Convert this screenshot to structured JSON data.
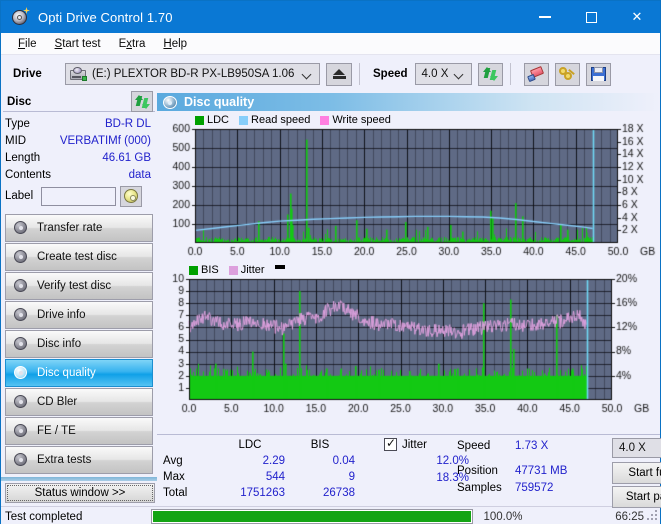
{
  "window": {
    "title": "Opti Drive Control 1.70",
    "app_icon": "disc-icon",
    "minimize": "minimize-icon",
    "maximize": "maximize-icon",
    "close": "close-icon",
    "titlebar_color": "#0a78d4"
  },
  "menu": [
    {
      "label": "File"
    },
    {
      "label": "Start test"
    },
    {
      "label": "Extra"
    },
    {
      "label": "Help"
    }
  ],
  "toolbar": {
    "drive_label": "Drive",
    "drive_value": "(E:)   PLEXTOR BD-R  PX-LB950SA 1.06",
    "eject_title": "eject-icon",
    "speed_label": "Speed",
    "speed_value": "4.0 X",
    "refresh_icon": "refresh-icon",
    "erase_icon": "eraser-icon",
    "keys_icon": "keys-icon",
    "save_icon": "save-icon"
  },
  "disc_panel": {
    "header": "Disc",
    "refresh_icon": "refresh-icon",
    "rows": [
      {
        "key": "Type",
        "value": "BD-R DL"
      },
      {
        "key": "MID",
        "value": "VERBATIMf (000)"
      },
      {
        "key": "Length",
        "value": "46.61 GB"
      },
      {
        "key": "Contents",
        "value": "data"
      }
    ],
    "label_key": "Label",
    "label_value": "",
    "label_placeholder": "",
    "label_button_icon": "cd-icon"
  },
  "nav": {
    "items": [
      {
        "label": "Transfer rate",
        "icon": "disc-transfer-icon",
        "active": false
      },
      {
        "label": "Create test disc",
        "icon": "disc-create-icon",
        "active": false
      },
      {
        "label": "Verify test disc",
        "icon": "disc-verify-icon",
        "active": false
      },
      {
        "label": "Drive info",
        "icon": "disc-drive-icon",
        "active": false
      },
      {
        "label": "Disc info",
        "icon": "disc-info-icon",
        "active": false
      },
      {
        "label": "Disc quality",
        "icon": "disc-quality-icon",
        "active": true
      },
      {
        "label": "CD Bler",
        "icon": "disc-bler-icon",
        "active": false
      },
      {
        "label": "FE / TE",
        "icon": "disc-fete-icon",
        "active": false
      },
      {
        "label": "Extra tests",
        "icon": "disc-extra-icon",
        "active": false
      }
    ],
    "status_window_button": "Status window >>"
  },
  "panel": {
    "title": "Disc quality",
    "title_icon": "disc-quality-icon"
  },
  "stats": {
    "col_headers": [
      "LDC",
      "BIS"
    ],
    "rows": [
      {
        "label": "Avg",
        "ldc": "2.29",
        "bis": "0.04"
      },
      {
        "label": "Max",
        "ldc": "544",
        "bis": "9"
      },
      {
        "label": "Total",
        "ldc": "1751263",
        "bis": "26738"
      }
    ],
    "jitter_label": "Jitter",
    "jitter_checked": true,
    "jitter_avg": "12.0%",
    "jitter_max": "18.3%",
    "speed_key": "Speed",
    "speed_value": "1.73 X",
    "position_key": "Position",
    "position_value": "47731 MB",
    "samples_key": "Samples",
    "samples_value": "759572",
    "speed_select": "4.0 X",
    "start_full": "Start full",
    "start_part": "Start part"
  },
  "statusbar": {
    "status": "Test completed",
    "progress_pct_label": "100.0%",
    "progress_value": 100,
    "elapsed": "66:25",
    "bar_color": "#13a413"
  },
  "chart_data": [
    {
      "type": "line",
      "name": "top-chart-ldc",
      "title": "",
      "xlabel": "GB",
      "ylabel": "",
      "xlim": [
        0,
        50
      ],
      "ylim": [
        0,
        600
      ],
      "y2lim": [
        0,
        18
      ],
      "grid": true,
      "legend": [
        {
          "label": "LDC",
          "color": "#00a000"
        },
        {
          "label": "Read speed",
          "color": "#87cefa"
        },
        {
          "label": "Write speed",
          "color": "#ff7fe0"
        }
      ],
      "xticks": [
        "0.0",
        "5.0",
        "10.0",
        "15.0",
        "20.0",
        "25.0",
        "30.0",
        "35.0",
        "40.0",
        "45.0",
        "50.0"
      ],
      "yticks": [
        "600",
        "500",
        "400",
        "300",
        "200",
        "100"
      ],
      "y2ticks": [
        "18 X",
        "16 X",
        "14 X",
        "12 X",
        "10 X",
        "8 X",
        "6 X",
        "4 X",
        "2 X"
      ],
      "data_end_gb": 47.0,
      "series": [
        {
          "name": "Read speed",
          "color": "#87cefa",
          "axis": "right",
          "x": [
            0,
            2,
            4,
            6,
            8,
            10,
            12,
            14,
            16,
            18,
            20,
            22,
            24,
            26,
            28,
            30,
            32,
            34,
            36,
            38,
            40,
            42,
            44,
            46,
            47
          ],
          "y": [
            2.0,
            2.3,
            2.6,
            2.9,
            3.2,
            3.45,
            3.6,
            3.75,
            3.85,
            3.95,
            4.05,
            4.1,
            4.15,
            4.2,
            4.2,
            4.2,
            4.15,
            4.1,
            3.95,
            3.7,
            3.4,
            3.1,
            2.8,
            2.5,
            2.3
          ]
        },
        {
          "name": "LDC",
          "color": "#00c000",
          "axis": "left",
          "note": "dense spike series, avg 2.29, max 544, total 1751263"
        }
      ],
      "spikes_ldc": [
        [
          7.4,
          115
        ],
        [
          10.9,
          150
        ],
        [
          11.2,
          260
        ],
        [
          11.35,
          180
        ],
        [
          11.5,
          95
        ],
        [
          13.1,
          544
        ],
        [
          13.3,
          80
        ],
        [
          16.6,
          90
        ],
        [
          19.0,
          120
        ],
        [
          20.2,
          75
        ],
        [
          22.6,
          70
        ],
        [
          24.8,
          110
        ],
        [
          27.4,
          85
        ],
        [
          30.2,
          95
        ],
        [
          31.6,
          60
        ],
        [
          34.9,
          170
        ],
        [
          35.1,
          130
        ],
        [
          37.8,
          210
        ],
        [
          38.6,
          140
        ],
        [
          43.2,
          95
        ],
        [
          44.0,
          70
        ],
        [
          46.2,
          55
        ]
      ],
      "cursor_gb": 47.0,
      "cursor_color": "#6fd8f5"
    },
    {
      "type": "line",
      "name": "bottom-chart-bis-jitter",
      "title": "",
      "xlabel": "GB",
      "ylabel": "",
      "xlim": [
        0,
        50
      ],
      "ylim": [
        0,
        10
      ],
      "y2lim": [
        0,
        20
      ],
      "grid": true,
      "legend": [
        {
          "label": "BIS",
          "color": "#00a000"
        },
        {
          "label": "Jitter",
          "color": "#dda0dd"
        },
        {
          "label": "",
          "color": "#000000"
        }
      ],
      "xticks": [
        "0.0",
        "5.0",
        "10.0",
        "15.0",
        "20.0",
        "25.0",
        "30.0",
        "35.0",
        "40.0",
        "45.0",
        "50.0"
      ],
      "yticks": [
        "10",
        "9",
        "8",
        "7",
        "6",
        "5",
        "4",
        "3",
        "2",
        "1"
      ],
      "y2ticks": [
        "20%",
        "16%",
        "12%",
        "8%",
        "4%"
      ],
      "data_end_gb": 47.0,
      "series": [
        {
          "name": "Jitter",
          "color": "#dda0dd",
          "axis": "right",
          "x": [
            0,
            1,
            2,
            3,
            4,
            5,
            6,
            7,
            8,
            9,
            10,
            11,
            12,
            13,
            14,
            15,
            16,
            17,
            18,
            19,
            20,
            22,
            24,
            26,
            28,
            30,
            32,
            34,
            36,
            38,
            40,
            42,
            44,
            46,
            47
          ],
          "y": [
            12.0,
            13.4,
            13.6,
            13.2,
            12.6,
            12.8,
            12.4,
            13.2,
            12.8,
            12.4,
            12.2,
            11.8,
            12.4,
            13.2,
            13.6,
            13.0,
            14.6,
            15.2,
            15.8,
            14.6,
            13.8,
            12.6,
            12.4,
            11.9,
            11.6,
            11.4,
            11.2,
            11.8,
            12.2,
            12.6,
            12.4,
            12.8,
            13.0,
            14.2,
            12.0
          ]
        },
        {
          "name": "BIS",
          "color": "#00c000",
          "axis": "left",
          "note": "dense spike series, avg 0.04, max 9, total 26738"
        }
      ],
      "spikes_bis": [
        [
          3.1,
          3.0
        ],
        [
          7.4,
          4.0
        ],
        [
          11.1,
          5.5
        ],
        [
          11.4,
          3.0
        ],
        [
          13.0,
          9.0
        ],
        [
          16.2,
          2.6
        ],
        [
          19.6,
          2.8
        ],
        [
          22.3,
          2.5
        ],
        [
          26.0,
          2.4
        ],
        [
          29.4,
          3.0
        ],
        [
          31.7,
          2.6
        ],
        [
          34.8,
          8.0
        ],
        [
          37.9,
          8.3
        ],
        [
          38.3,
          4.2
        ],
        [
          43.4,
          7.0
        ],
        [
          45.3,
          2.6
        ]
      ],
      "cursor_gb": 47.0,
      "cursor_color": "#6fd8f5"
    }
  ]
}
